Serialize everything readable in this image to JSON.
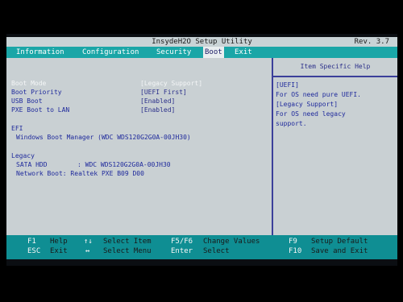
{
  "title": "InsydeH2O Setup Utility",
  "rev": "Rev. 3.7",
  "menu": {
    "information": "Information",
    "configuration": "Configuration",
    "security": "Security",
    "boot": "Boot",
    "exit": "Exit"
  },
  "settings": {
    "boot_mode": {
      "label": "Boot Mode",
      "value": "[Legacy Support]"
    },
    "boot_priority": {
      "label": "Boot Priority",
      "value": "[UEFI First]"
    },
    "usb_boot": {
      "label": "USB Boot",
      "value": "[Enabled]"
    },
    "pxe_boot": {
      "label": "PXE Boot to LAN",
      "value": "[Enabled]"
    }
  },
  "efi": {
    "heading": "EFI",
    "item": "Windows Boot Manager (WDC WDS120G2G0A-00JH30)"
  },
  "legacy": {
    "heading": "Legacy",
    "sata_label": "SATA HDD",
    "sata_value": ": WDC WDS120G2G0A-00JH30",
    "network": "Network Boot: Realtek PXE B09 D00"
  },
  "help": {
    "heading": "Item Specific Help",
    "line1": "[UEFI]",
    "line2": "For OS need pure UEFI.",
    "line3": "[Legacy Support]",
    "line4": "For OS need legacy",
    "line5": "support."
  },
  "footer": {
    "f1_key": "F1",
    "f1_desc": "Help",
    "esc_key": "ESC",
    "esc_desc": "Exit",
    "ud_key": "↑↓",
    "ud_desc": "Select Item",
    "lr_key": "↔",
    "lr_desc": "Select Menu",
    "f5f6_key": "F5/F6",
    "f5f6_desc": "Change Values",
    "enter_key": "Enter",
    "enter_desc": "Select",
    "f9_key": "F9",
    "f9_desc": "Setup Default",
    "f10_key": "F10",
    "f10_desc": "Save and Exit"
  },
  "colors": {
    "menu_bar": "#1aa6a7",
    "panel": "#c9d0d3",
    "footer": "#0f8e93",
    "value_text": "#2b2f8a",
    "highlight_text": "#f4f6f7"
  }
}
